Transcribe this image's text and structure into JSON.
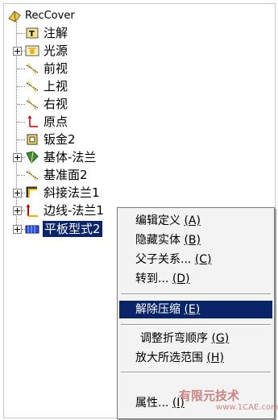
{
  "tree": {
    "root": "RecCover",
    "items": [
      {
        "label": "注解",
        "icon": "annotation-icon",
        "expandable": false
      },
      {
        "label": "光源",
        "icon": "light-source-icon",
        "expandable": true
      },
      {
        "label": "前视",
        "icon": "plane-icon",
        "expandable": false
      },
      {
        "label": "上视",
        "icon": "plane-icon",
        "expandable": false
      },
      {
        "label": "右视",
        "icon": "plane-icon",
        "expandable": false
      },
      {
        "label": "原点",
        "icon": "origin-icon",
        "expandable": false
      },
      {
        "label": "钣金2",
        "icon": "sheet-metal-icon",
        "expandable": false
      },
      {
        "label": "基体-法兰",
        "icon": "base-flange-icon",
        "expandable": true
      },
      {
        "label": "基准面2",
        "icon": "plane-icon",
        "expandable": false
      },
      {
        "label": "斜接法兰1",
        "icon": "miter-flange-icon",
        "expandable": true
      },
      {
        "label": "边线-法兰1",
        "icon": "edge-flange-icon",
        "expandable": true
      },
      {
        "label": "平板型式2",
        "icon": "flat-pattern-icon",
        "expandable": true,
        "selected": true
      }
    ]
  },
  "context_menu": {
    "items": [
      {
        "label": "编辑定义 ",
        "accel": "(A)"
      },
      {
        "label": "隐藏实体 ",
        "accel": "(B)"
      },
      {
        "label": "父子关系... ",
        "accel": "(C)"
      },
      {
        "label": "转到... ",
        "accel": "(D)"
      },
      {
        "label": "解除压缩 ",
        "accel": "(E)",
        "highlighted": true
      },
      {
        "label": "调整折弯顺序 ",
        "accel": "(G)"
      },
      {
        "label": "放大所选范围 ",
        "accel": "(H)"
      },
      {
        "label": "属性... ",
        "accel": "(I)"
      }
    ]
  },
  "watermark": {
    "main": "有限元技术",
    "sub": "www.1CAE.com"
  },
  "colors": {
    "selection": "#0a246a",
    "menu_bg": "#f3f3f3"
  }
}
